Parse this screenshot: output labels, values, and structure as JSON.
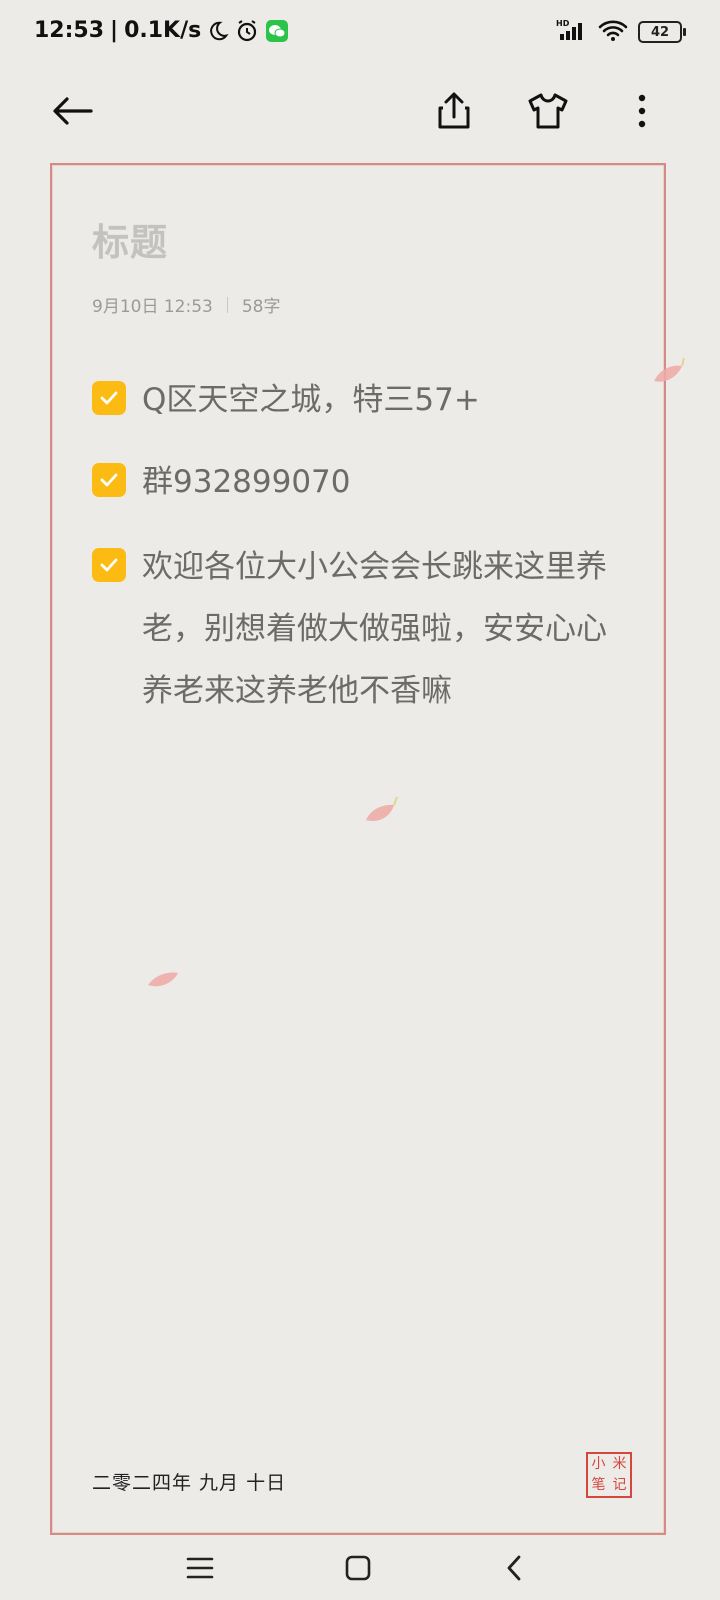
{
  "status": {
    "time": "12:53",
    "network_speed": "0.1K/s",
    "battery": "42",
    "hd_label": "HD"
  },
  "toolbar": {
    "back_icon": "back-arrow-icon",
    "share_icon": "share-icon",
    "theme_icon": "tshirt-icon",
    "more_icon": "more-vertical-icon"
  },
  "note": {
    "title_placeholder": "标题",
    "date": "9月10日 12:53",
    "word_count": "58字",
    "todos": [
      {
        "text": "Q区天空之城，特三57+",
        "checked": true
      },
      {
        "text": "群932899070",
        "checked": true
      },
      {
        "text": "欢迎各位大小公会会长跳来这里养老，别想着做大做强啦，安安心心养老来这养老他不香嘛",
        "checked": true
      }
    ],
    "footer_date": "二零二四年 九月 十日",
    "seal_text": "小米笔记"
  },
  "colors": {
    "accent": "#fbbb12",
    "frame": "#d58b84",
    "seal": "#d5463c",
    "background": "#ecebe7"
  }
}
